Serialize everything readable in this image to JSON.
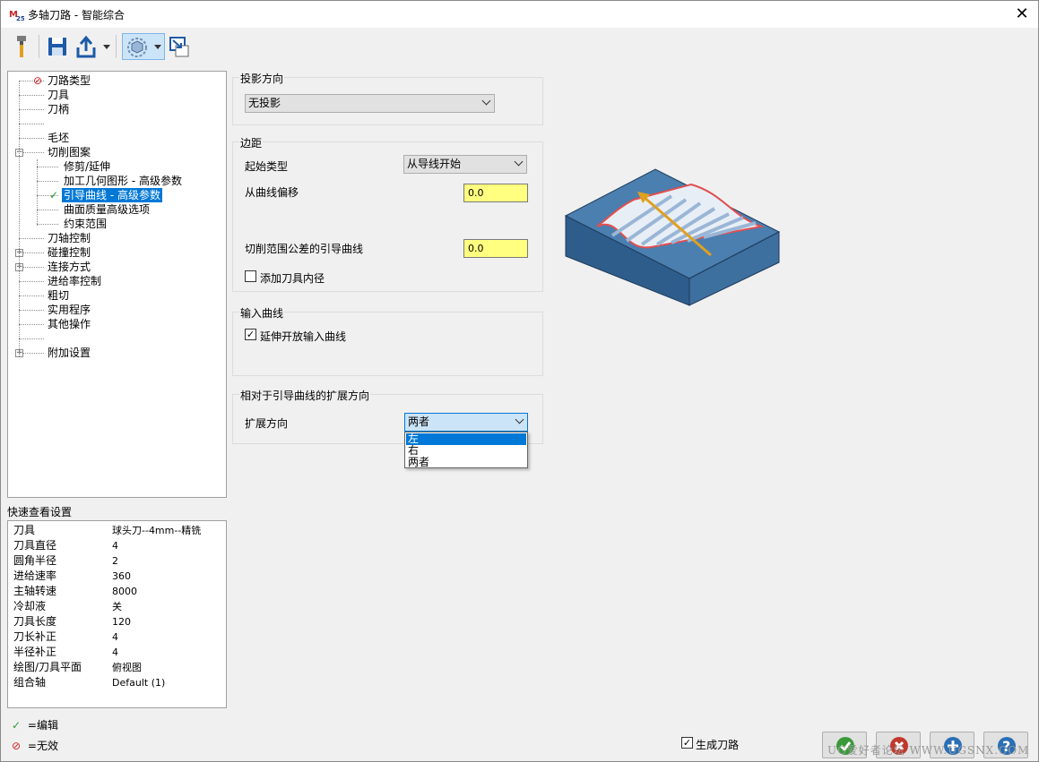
{
  "window": {
    "title": "多轴刀路 - 智能综合",
    "close_glyph": "✕"
  },
  "toolbar": {
    "items": [
      "hammer-icon",
      "save-icon",
      "export-icon",
      "dropdown-arrow",
      "view-cube-icon",
      "dropdown-arrow",
      "window-arrow-icon"
    ]
  },
  "tree": {
    "items": [
      {
        "label": "刀路类型",
        "depth": 0,
        "icon": "invalid-icon"
      },
      {
        "label": "刀具",
        "depth": 0
      },
      {
        "label": "刀柄",
        "depth": 0
      },
      {
        "label": "",
        "depth": 0
      },
      {
        "label": "毛坯",
        "depth": 0
      },
      {
        "label": "切削图案",
        "depth": 0,
        "expander": "−"
      },
      {
        "label": "修剪/延伸",
        "depth": 1
      },
      {
        "label": "加工几何图形 - 高级参数",
        "depth": 1
      },
      {
        "label": "引导曲线 - 高级参数",
        "depth": 1,
        "icon": "edited-icon",
        "selected": true
      },
      {
        "label": "曲面质量高级选项",
        "depth": 1
      },
      {
        "label": "约束范围",
        "depth": 1
      },
      {
        "label": "刀轴控制",
        "depth": 0
      },
      {
        "label": "碰撞控制",
        "depth": 0,
        "expander": "+"
      },
      {
        "label": "连接方式",
        "depth": 0,
        "expander": "+"
      },
      {
        "label": "进给率控制",
        "depth": 0
      },
      {
        "label": "粗切",
        "depth": 0
      },
      {
        "label": "实用程序",
        "depth": 0
      },
      {
        "label": "其他操作",
        "depth": 0
      },
      {
        "label": "",
        "depth": 0
      },
      {
        "label": "附加设置",
        "depth": 0,
        "expander": "+"
      }
    ]
  },
  "quick_view": {
    "title": "快速查看设置",
    "rows": [
      {
        "k": "刀具",
        "v": "球头刀--4mm--精铣"
      },
      {
        "k": "刀具直径",
        "v": "4"
      },
      {
        "k": "圆角半径",
        "v": "2"
      },
      {
        "k": "进给速率",
        "v": "360"
      },
      {
        "k": "主轴转速",
        "v": "8000"
      },
      {
        "k": "冷却液",
        "v": "关"
      },
      {
        "k": "刀具长度",
        "v": "120"
      },
      {
        "k": "刀长补正",
        "v": "4"
      },
      {
        "k": "半径补正",
        "v": "4"
      },
      {
        "k": "绘图/刀具平面",
        "v": "俯视图"
      },
      {
        "k": "组合轴",
        "v": "Default (1)"
      }
    ]
  },
  "legend": {
    "edit_glyph": "✓",
    "edit_label": "=编辑",
    "invalid_glyph": "⊘",
    "invalid_label": "=无效"
  },
  "projection": {
    "group": "投影方向",
    "value": "无投影"
  },
  "margin": {
    "group": "边距",
    "start_type_label": "起始类型",
    "start_type_value": "从导线开始",
    "offset_label": "从曲线偏移",
    "offset_value": "0.0",
    "tol_label": "切削范围公差的引导曲线",
    "tol_value": "0.0",
    "add_radius_label": "添加刀具内径",
    "add_radius_checked": false
  },
  "input_curve": {
    "group": "输入曲线",
    "extend_label": "延伸开放输入曲线",
    "extend_checked": true
  },
  "extension": {
    "group": "相对于引导曲线的扩展方向",
    "dir_label": "扩展方向",
    "dir_value": "两者",
    "options": [
      "左",
      "右",
      "两者"
    ],
    "highlighted": "左"
  },
  "bottom": {
    "generate_label": "生成刀路",
    "generate_checked": true,
    "check_glyph": "✓",
    "watermark": "UG爱好者论坛 WWW.UGSNX.COM"
  },
  "colors": {
    "accent": "#0078d7",
    "edit_yellow": "#ffff80",
    "ok_green": "#3a9a3a",
    "cancel_red": "#c0392b",
    "add_blue": "#2a6fb5",
    "help_blue": "#2a6fb5",
    "invalid_red": "#d42020",
    "edited_green": "#2f9a2f"
  }
}
